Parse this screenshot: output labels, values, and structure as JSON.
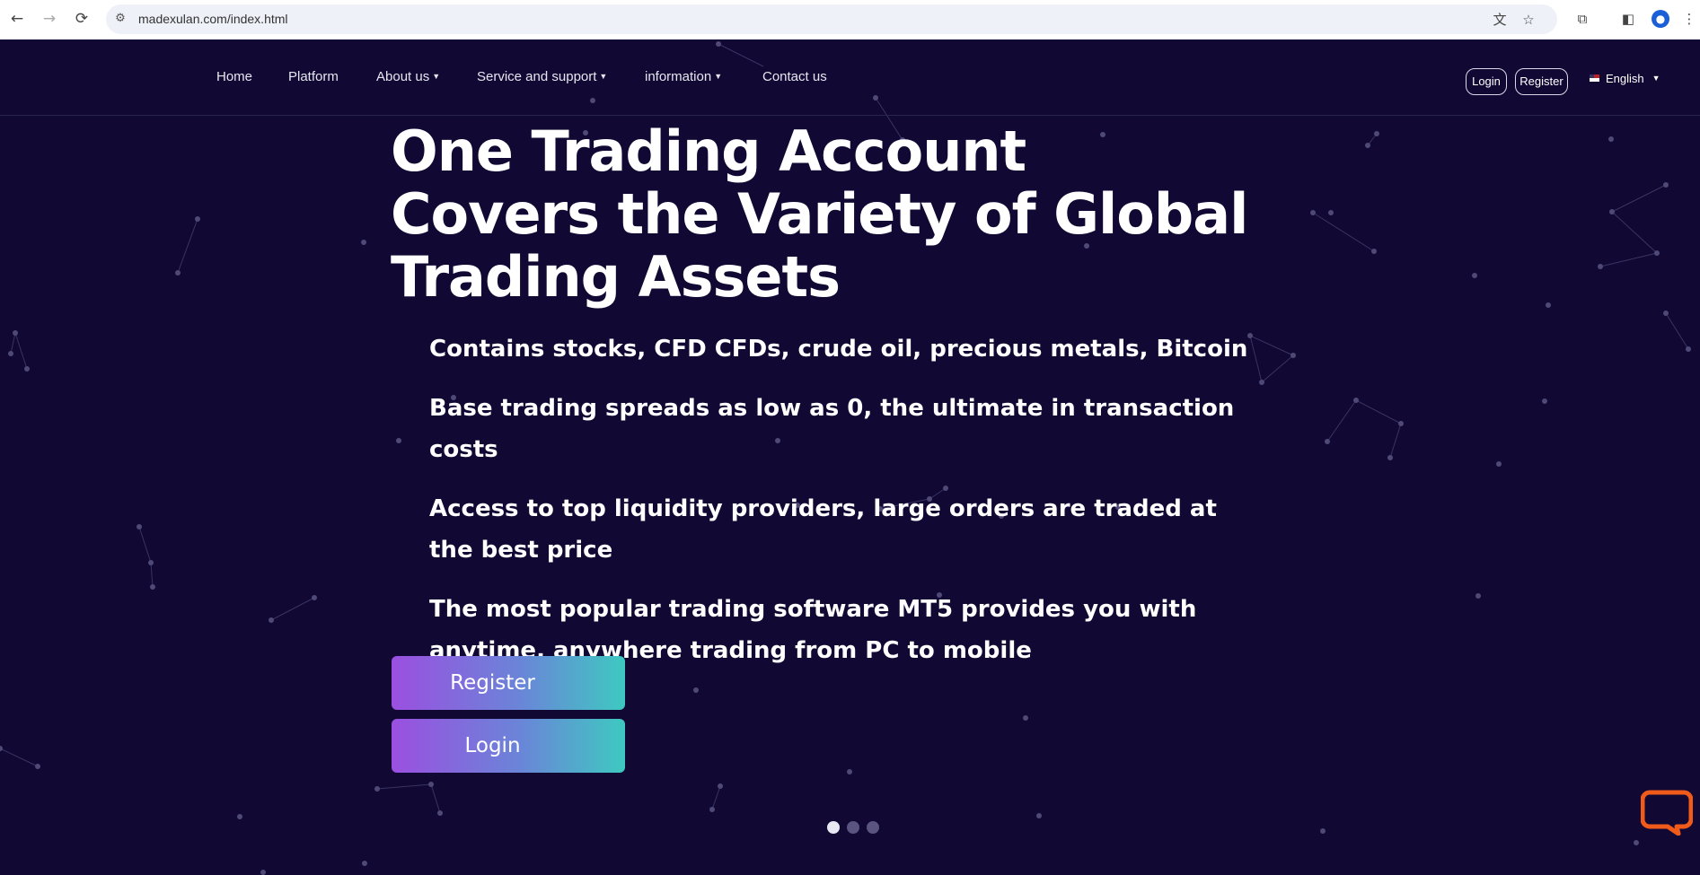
{
  "browser": {
    "url": "madexulan.com/index.html",
    "back_icon": "←",
    "forward_icon": "→",
    "reload_icon": "⟳"
  },
  "nav": {
    "items": [
      "Home",
      "Platform",
      "About us",
      "Service and support",
      "information",
      "Contact us"
    ],
    "login": "Login",
    "register": "Register",
    "language": "English"
  },
  "hero": {
    "title_lines": [
      "One Trading Account",
      "Covers the Variety of Global",
      "Trading Assets"
    ],
    "features": [
      "Contains stocks, CFD CFDs, crude oil, precious metals, Bitcoin",
      "Base trading spreads as low as 0, the ultimate in transaction costs",
      "Access to top liquidity providers, large orders are traded at the best price",
      "The most popular trading software MT5 provides you with anytime, anywhere trading from PC to mobile"
    ],
    "register_button": "Register",
    "login_button": "Login"
  },
  "carousel": {
    "slides": 3,
    "active": 1
  },
  "colors": {
    "background": "#110933",
    "gradient_start": "#9b4fe0",
    "gradient_end": "#3ec9c1",
    "chat_icon": "#f05a1a"
  }
}
